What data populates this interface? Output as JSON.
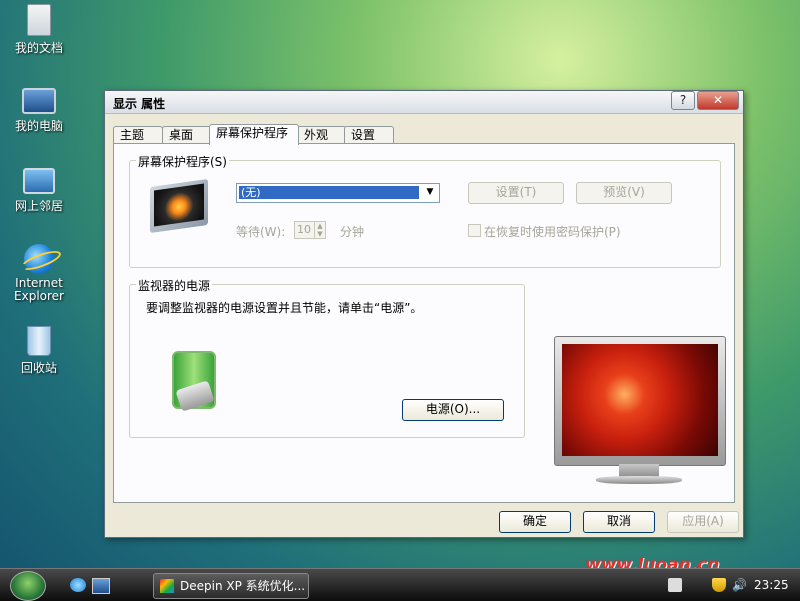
{
  "desktop": {
    "icons": [
      {
        "label": "我的文档",
        "icon": "documents-icon"
      },
      {
        "label": "我的电脑",
        "icon": "computer-icon"
      },
      {
        "label": "网上邻居",
        "icon": "network-icon"
      },
      {
        "label": "Internet\nExplorer",
        "icon": "ie-icon"
      },
      {
        "label": "回收站",
        "icon": "recycle-bin-icon"
      }
    ]
  },
  "dialog": {
    "title": "显示 属性",
    "help_label": "?",
    "close_label": "✕",
    "tabs": [
      {
        "label": "主题"
      },
      {
        "label": "桌面"
      },
      {
        "label": "屏幕保护程序",
        "active": true
      },
      {
        "label": "外观"
      },
      {
        "label": "设置"
      }
    ],
    "screensaver": {
      "group_label": "屏幕保护程序(S)",
      "selected": "(无)",
      "settings_button": "设置(T)",
      "preview_button": "预览(V)",
      "wait_label": "等待(W):",
      "wait_value": "10",
      "minutes_label": "分钟",
      "password_checkbox": "在恢复时使用密码保护(P)"
    },
    "power": {
      "group_label": "监视器的电源",
      "description": "要调整监视器的电源设置并且节能，请单击“电源”。",
      "power_button": "电源(O)..."
    },
    "buttons": {
      "ok": "确定",
      "cancel": "取消",
      "apply": "应用(A)"
    }
  },
  "taskbar": {
    "task_label": "Deepin XP 系统优化...",
    "clock": "23:25"
  },
  "watermark": {
    "text": "www.luoan.cn"
  }
}
